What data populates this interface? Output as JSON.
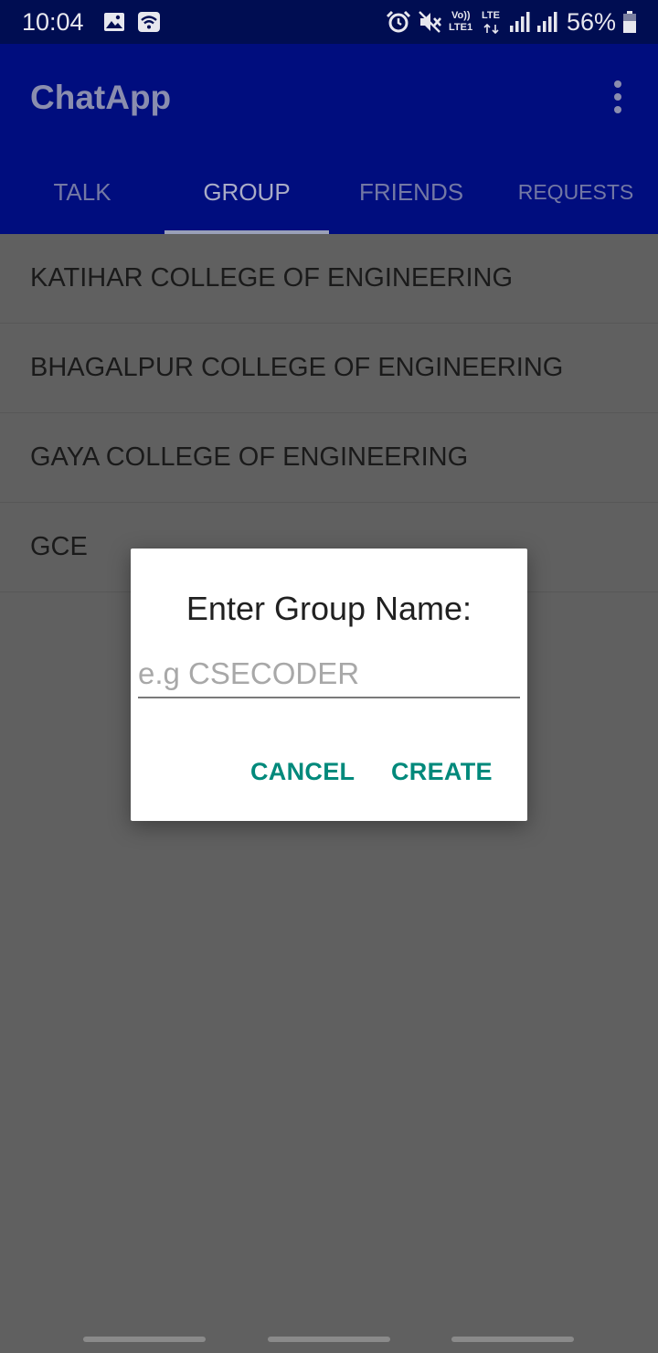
{
  "status_bar": {
    "time": "10:04",
    "battery": "56%",
    "volte_top": "Vo))",
    "volte_bottom": "LTE1",
    "lte": "LTE",
    "icons": [
      "image-icon",
      "wifi-icon",
      "alarm-icon",
      "mute-icon",
      "volte-icon",
      "lte-icon",
      "signal-icon",
      "signal-icon",
      "battery-icon"
    ]
  },
  "app_bar": {
    "title": "ChatApp",
    "menu_icon": "more-vert-icon"
  },
  "tabs": [
    {
      "label": "TALK",
      "active": false
    },
    {
      "label": "GROUP",
      "active": true
    },
    {
      "label": "FRIENDS",
      "active": false
    },
    {
      "label": "REQUESTS",
      "active": false
    }
  ],
  "groups": [
    {
      "name": "KATIHAR COLLEGE OF ENGINEERING"
    },
    {
      "name": "BHAGALPUR COLLEGE OF ENGINEERING"
    },
    {
      "name": "GAYA COLLEGE OF ENGINEERING"
    },
    {
      "name": "GCE"
    }
  ],
  "dialog": {
    "title": "Enter Group Name:",
    "input_value": "",
    "input_placeholder": "e.g CSECODER",
    "cancel_label": "CANCEL",
    "create_label": "CREATE"
  },
  "colors": {
    "accent": "#00897b",
    "app_bar": "#000d7e",
    "status_bar": "#000d52"
  }
}
